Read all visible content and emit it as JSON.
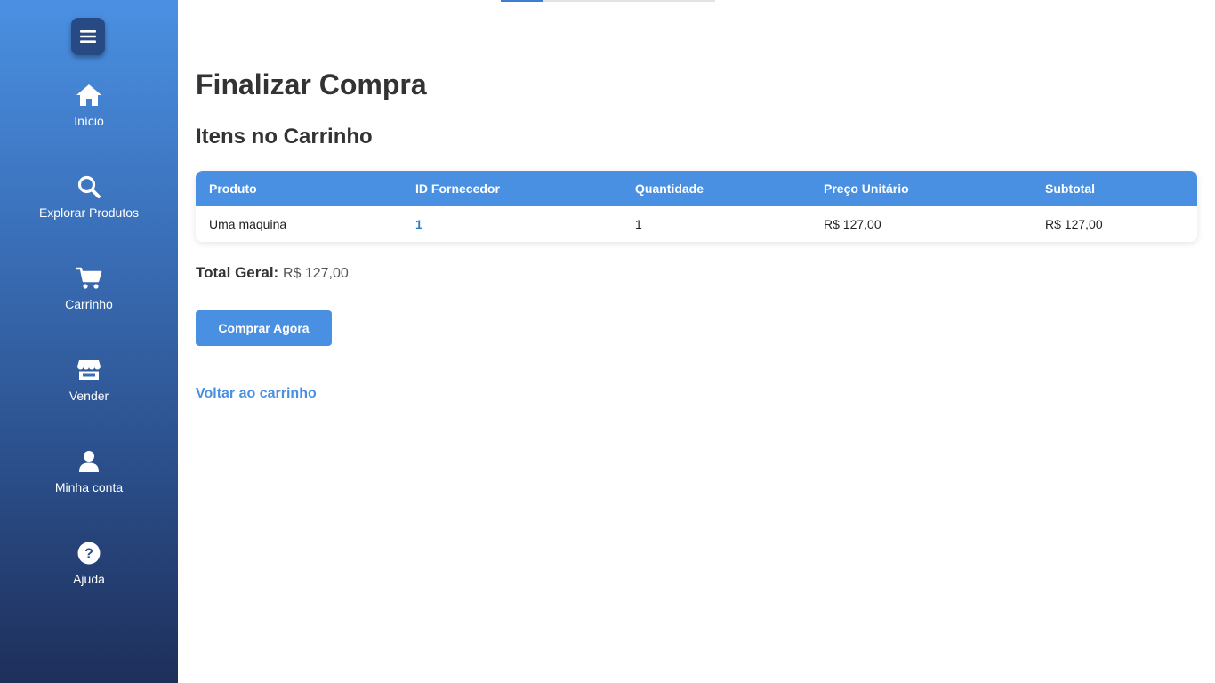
{
  "sidebar": {
    "menu_icon": "hamburger-icon",
    "items": [
      {
        "label": "Início",
        "icon": "home-icon"
      },
      {
        "label": "Explorar Produtos",
        "icon": "search-icon"
      },
      {
        "label": "Carrinho",
        "icon": "cart-icon"
      },
      {
        "label": "Vender",
        "icon": "store-icon"
      },
      {
        "label": "Minha conta",
        "icon": "user-icon"
      },
      {
        "label": "Ajuda",
        "icon": "help-icon"
      }
    ]
  },
  "page": {
    "title": "Finalizar Compra",
    "subtitle": "Itens no Carrinho"
  },
  "table": {
    "headers": [
      "Produto",
      "ID Fornecedor",
      "Quantidade",
      "Preço Unitário",
      "Subtotal"
    ],
    "rows": [
      {
        "produto": "Uma maquina",
        "fornecedor": "1",
        "quantidade": "1",
        "preco": "R$ 127,00",
        "subtotal": "R$ 127,00"
      }
    ]
  },
  "total": {
    "label": "Total Geral:",
    "value": "R$ 127,00"
  },
  "actions": {
    "buy_label": "Comprar Agora",
    "back_label": "Voltar ao carrinho"
  },
  "colors": {
    "accent": "#4a90e2",
    "sidebar_top": "#4a90e2",
    "sidebar_bottom": "#1e2f5a"
  }
}
